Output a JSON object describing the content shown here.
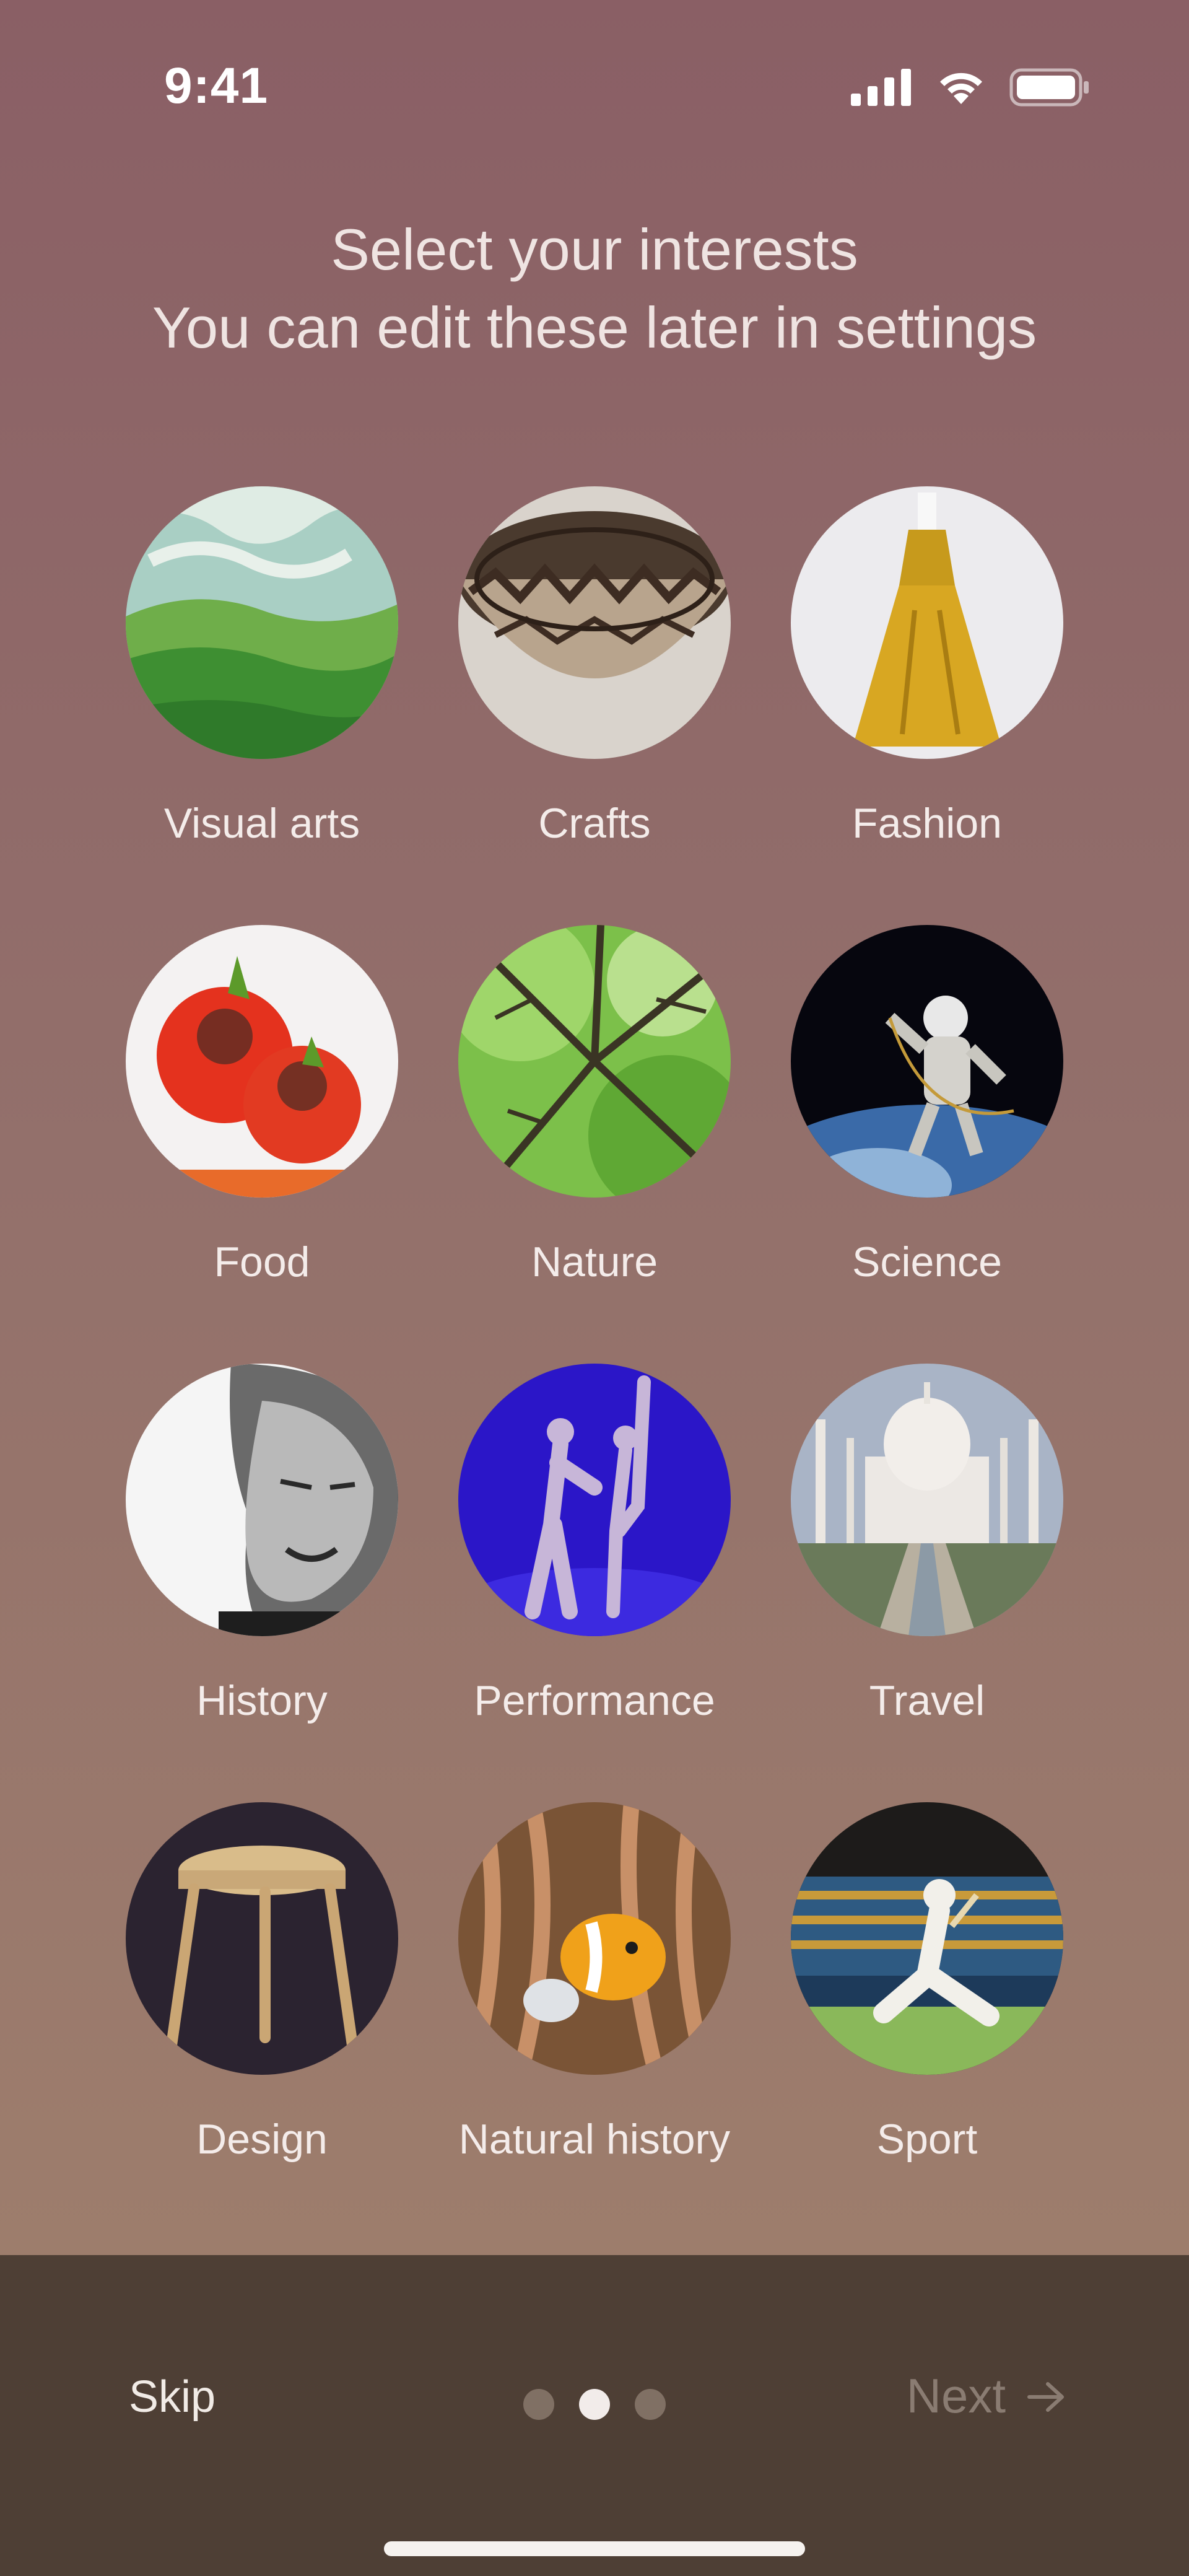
{
  "status_bar": {
    "time": "9:41",
    "icons": [
      "cellular-signal-icon",
      "wifi-icon",
      "battery-icon"
    ]
  },
  "header": {
    "title": "Select your interests",
    "subtitle": "You can edit these later in settings"
  },
  "interests": [
    {
      "label": "Visual arts",
      "icon": "painting-landscape"
    },
    {
      "label": "Crafts",
      "icon": "ceramic-bowl"
    },
    {
      "label": "Fashion",
      "icon": "yellow-dress"
    },
    {
      "label": "Food",
      "icon": "tomato-dish"
    },
    {
      "label": "Nature",
      "icon": "tree-canopy"
    },
    {
      "label": "Science",
      "icon": "astronaut"
    },
    {
      "label": "History",
      "icon": "portrait"
    },
    {
      "label": "Performance",
      "icon": "dancers"
    },
    {
      "label": "Travel",
      "icon": "taj-mahal"
    },
    {
      "label": "Design",
      "icon": "stool"
    },
    {
      "label": "Natural history",
      "icon": "clownfish"
    },
    {
      "label": "Sport",
      "icon": "cricket"
    }
  ],
  "footer": {
    "skip_label": "Skip",
    "next_label": "Next",
    "page_indicator": {
      "total": 3,
      "current": 2
    }
  },
  "colors": {
    "bg_top": "#8a5f65",
    "bg_bottom": "#a0816c",
    "bottom_bar": "#4e3f35",
    "next_disabled": "#8a7c72"
  }
}
